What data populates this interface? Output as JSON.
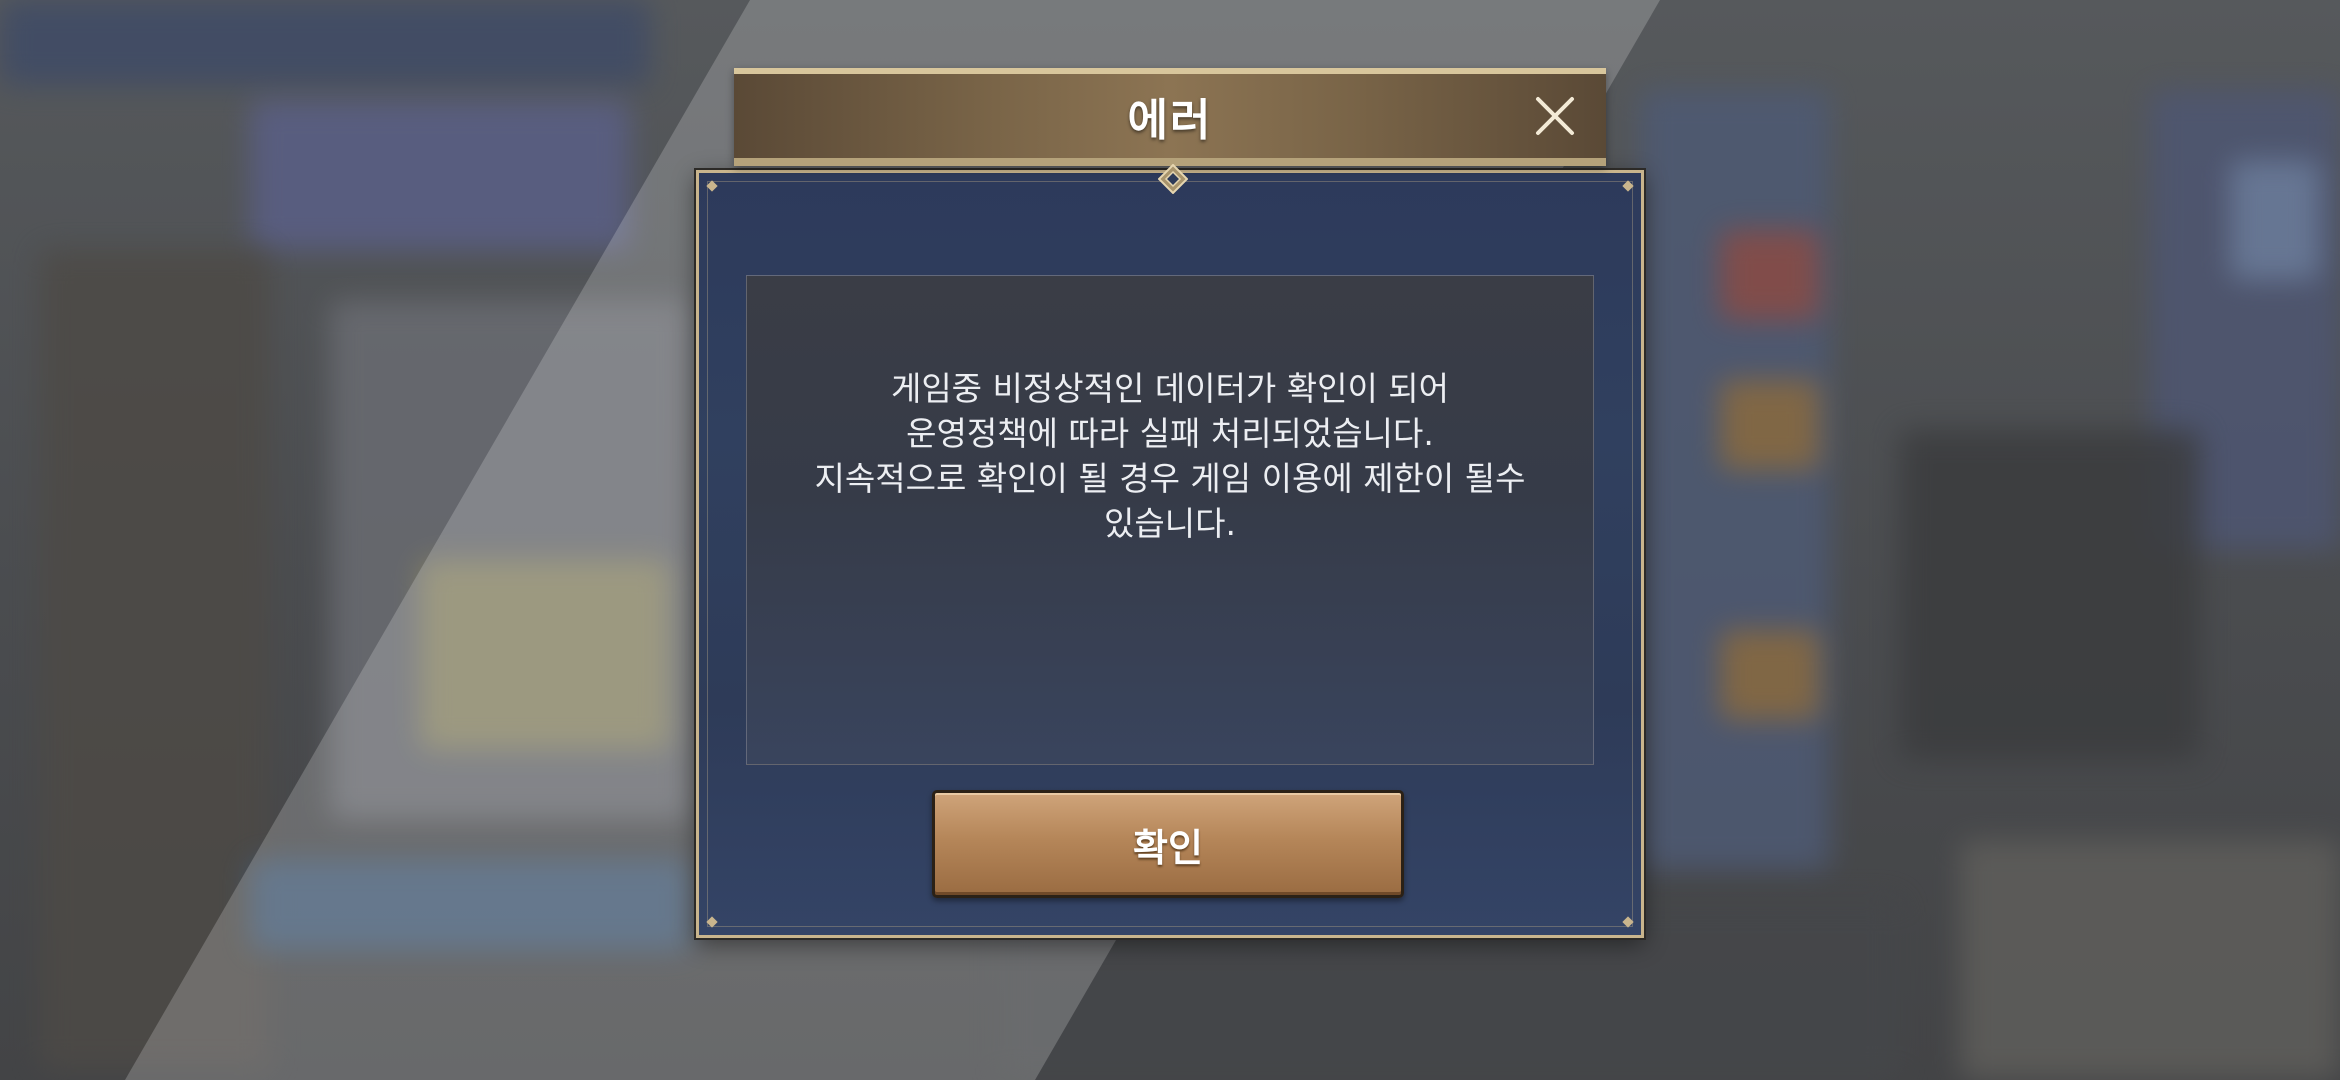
{
  "dialog": {
    "title": "에러",
    "message_lines": [
      "게임중 비정상적인 데이터가 확인이 되어",
      "운영정책에 따라 실패 처리되었습니다.",
      "지속적으로 확인이 될 경우 게임 이용에 제한이 될수",
      "있습니다."
    ],
    "confirm_label": "확인",
    "close_icon": "close-icon",
    "ornament_icon": "diamond-ornament-icon"
  },
  "colors": {
    "title_bar": "#7a6548",
    "frame_gold": "#c9b58d",
    "panel_navy": "#2e3b58",
    "button_bronze": "#b58659"
  }
}
